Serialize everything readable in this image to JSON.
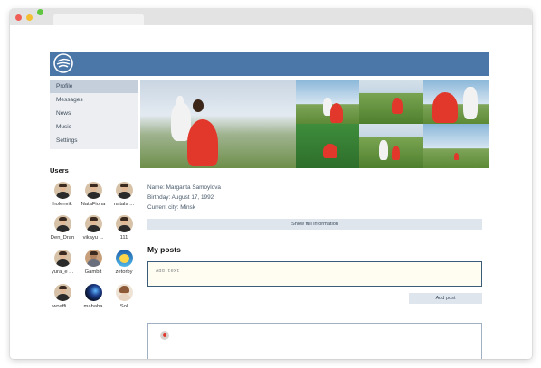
{
  "menu": {
    "items": [
      {
        "label": "Profile"
      },
      {
        "label": "Messages"
      },
      {
        "label": "News"
      },
      {
        "label": "Music"
      },
      {
        "label": "Settings"
      }
    ]
  },
  "users": {
    "title": "Users",
    "list": [
      {
        "name": "holenvik"
      },
      {
        "name": "NataFiona"
      },
      {
        "name": "natala ..."
      },
      {
        "name": "Den_Dran"
      },
      {
        "name": "vikayu ..."
      },
      {
        "name": "111"
      },
      {
        "name": "yura_e ..."
      },
      {
        "name": "Gambit"
      },
      {
        "name": "zetorby"
      },
      {
        "name": "woaffi ..."
      },
      {
        "name": "mahaha"
      },
      {
        "name": "Sol"
      }
    ]
  },
  "profile": {
    "name_line": "Name: Margarita Samoylova",
    "birthday_line": "Birthday: August 17, 1992",
    "city_line": "Current city: Minsk",
    "show_full_label": "Show full information"
  },
  "posts": {
    "title": "My posts",
    "input_placeholder": "Add text",
    "add_button_label": "Add post"
  },
  "colors": {
    "topbar": "#4a76a8",
    "menu_bg": "#eceef1",
    "menu_active": "#c5cfdc",
    "button_bg": "#dfe5ec",
    "input_border": "#3b5b7a"
  }
}
